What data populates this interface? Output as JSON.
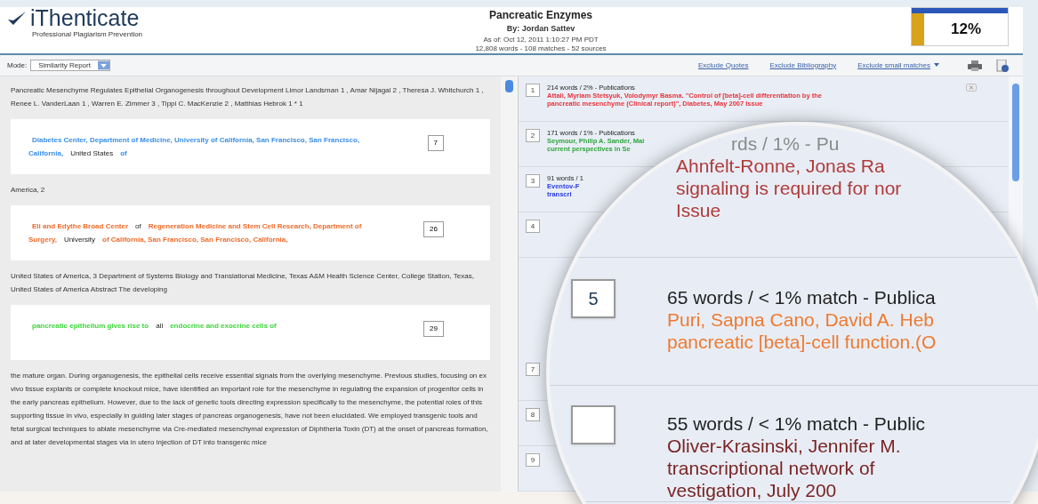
{
  "header": {
    "logo": "iThenticate",
    "tagline": "Professional Plagiarism Prevention",
    "title": "Pancreatic Enzymes",
    "author": "By: Jordan Sattev",
    "date": "As of: Oct 12, 2011 1:10:27 PM PDT",
    "stats": "12,808 words - 108 matches - 52 sources",
    "similarity": "12%"
  },
  "toolbar": {
    "mode_label": "Mode:",
    "mode_value": "Similarity Report",
    "links": [
      "Exclude Quotes",
      "Exclude Bibliography",
      "Exclude small matches"
    ]
  },
  "document": [
    {
      "kind": "text",
      "text": "Pancreatic Mesenchyme Regulates Epithelial Organogenesis throughout Development Limor Landsman 1 , Amar Nijagal 2 , Theresa J. Whitchurch 1 , Renee L. VanderLaan 1 , Warren E. Zimmer 3 , Tippi C. MacKenzie 2 , Matthias Hebrok 1 * 1"
    },
    {
      "kind": "match",
      "color": "#3a8ee6",
      "badge": "7",
      "segments": [
        {
          "kind": "match",
          "text": "Diabetes Center, Department of Medicine, University of California, San Francisco, San Francisco, California,"
        },
        {
          "kind": "plain",
          "text": "United States"
        },
        {
          "kind": "match",
          "text": "of"
        }
      ]
    },
    {
      "kind": "text",
      "text": "America, 2"
    },
    {
      "kind": "match",
      "color": "#f06a28",
      "badge": "26",
      "segments": [
        {
          "kind": "match",
          "text": "Eli and Edythe Broad Center"
        },
        {
          "kind": "plain",
          "text": "of"
        },
        {
          "kind": "match",
          "text": "Regeneration Medicine and Stem Cell Research, Department of Surgery,"
        },
        {
          "kind": "plain",
          "text": "University"
        },
        {
          "kind": "match",
          "text": "of California, San Francisco, San Francisco, California,"
        }
      ]
    },
    {
      "kind": "text",
      "text": "United States of America, 3 Department of Systems Biology and Translational Medicine, Texas A&M Health Science Center, College Station, Texas, United States of America Abstract The developing"
    },
    {
      "kind": "match",
      "color": "#3ed43a",
      "badge": "29",
      "segments": [
        {
          "kind": "match",
          "text": "pancreatic epithelium gives rise to"
        },
        {
          "kind": "plain",
          "text": "all"
        },
        {
          "kind": "match",
          "text": "endocrine and exocrine cells of"
        }
      ]
    },
    {
      "kind": "text",
      "text": "the mature organ. During organogenesis, the epithelial cells receive essential signals from the overlying mesenchyme. Previous studies, focusing on ex vivo tissue explants or complete knockout mice, have identified an important role for the mesenchyme in regulating the expansion of progenitor cells in the early pancreas epithelium. However, due to the lack of genetic tools directing expression specifically to the mesenchyme, the potential roles of this supporting tissue in vivo, especially in guiding later stages of pancreas organogenesis, have not been elucidated. We employed transgenic tools and fetal surgical techniques to ablate mesenchyme via Cre-mediated mesenchymal expression of Diphtheria Toxin (DT) at the onset of pancreas formation, and at later developmental stages via in utero injection of DT into transgenic mice"
    }
  ],
  "sources_top": [
    {
      "number": "1",
      "header": "214 words / 2% - Publications",
      "lines": [
        "Attali, Myriam Stetsyuk, Volodymyr Basma. \"Control of [beta]-cell differentiation by the",
        "pancreatic mesenchyme (Clinical report)\", Diabetes, May 2007 Issue"
      ],
      "color": "#e8323a"
    },
    {
      "number": "2",
      "header": "171 words / 1% - Publications",
      "lines": [
        "Seymour, Philip A. Sander, Mai",
        "current perspectives in Se"
      ],
      "color": "#2ea53a"
    },
    {
      "number": "3",
      "header": "91 words / 1",
      "lines": [
        "Eventov-F",
        "transcri"
      ],
      "color": "#2a3ae0"
    },
    {
      "number": "4"
    }
  ],
  "sources_bottom": [
    {
      "number": "7"
    },
    {
      "number": "8"
    },
    {
      "number": "9"
    }
  ],
  "lens": [
    {
      "header": "rds / 1% - Pu",
      "lines": [
        "Ahnfelt-Ronne, Jonas Ra",
        "signaling is required for nor",
        "Issue"
      ],
      "color": "#b03a3a"
    },
    {
      "number": "5",
      "header": "65 words / < 1% match - Publica",
      "lines": [
        "Puri, Sapna Cano, David A. Heb",
        "pancreatic [beta]-cell function.(O"
      ],
      "color": "#ee7a30"
    },
    {
      "header": "55 words / < 1% match - Public",
      "lines": [
        "Oliver-Krasinski, Jennifer M.",
        "transcriptional network of",
        "vestigation, July 200"
      ],
      "color": "#7a2424"
    }
  ]
}
